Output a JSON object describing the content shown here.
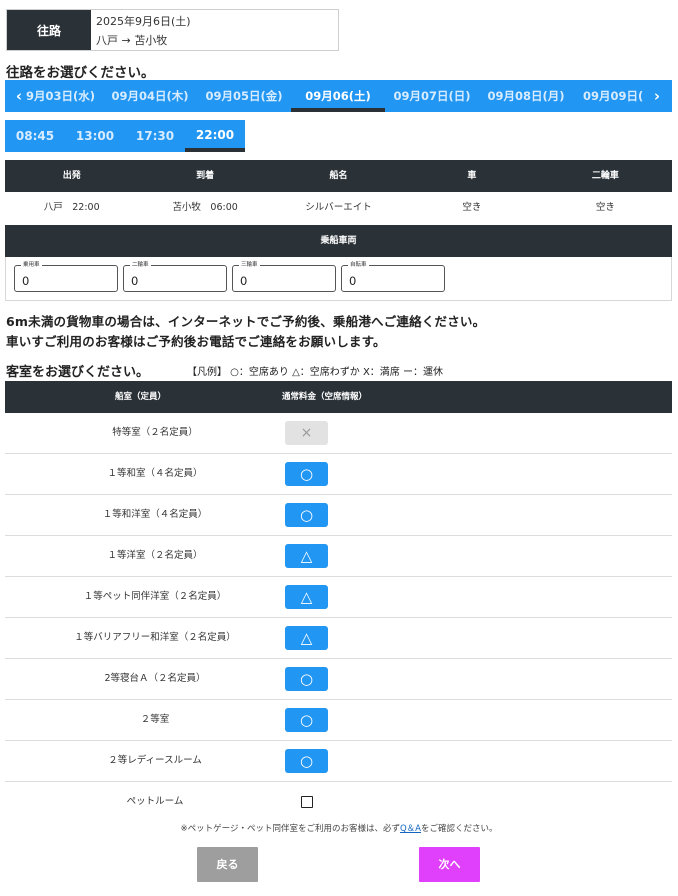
{
  "route": {
    "label": "往路",
    "date": "2025年9月6日(土)",
    "path": "八戸 → 苫小牧"
  },
  "date_section_title": "往路をお選びください。",
  "dates": {
    "prev_icon": "‹",
    "next_icon": "›",
    "items": [
      "9月03日(水)",
      "09月04日(木)",
      "09月05日(金)",
      "09月06(土)",
      "09月07日(日)",
      "09月08日(月)",
      "09月09日("
    ],
    "active_index": 3
  },
  "times": {
    "items": [
      "08:45",
      "13:00",
      "17:30",
      "22:00"
    ],
    "active_index": 3
  },
  "schedule": {
    "headers": [
      "出発",
      "到着",
      "船名",
      "車",
      "二輪車"
    ],
    "row": [
      "八戸　22:00",
      "苫小牧　06:00",
      "シルバーエイト",
      "空き",
      "空き"
    ]
  },
  "vehicles": {
    "header": "乗船車両",
    "fields": [
      {
        "legend": "乗用車",
        "value": "0"
      },
      {
        "legend": "二輪車",
        "value": "0"
      },
      {
        "legend": "三輪車",
        "value": "0"
      },
      {
        "legend": "自転車",
        "value": "0"
      }
    ]
  },
  "notice": {
    "line1": "6m未満の貨物車の場合は、インターネットでご予約後、乗船港へご連絡ください。",
    "line2": "車いすご利用のお客様はご予約後お電話でご連絡をお願いします。"
  },
  "rooms": {
    "title": "客室をお選びください。",
    "legend": "【凡例】 ○：空席あり △：空席わずか X：満席 ー：運休",
    "headers": {
      "name": "船室（定員）",
      "price": "通常料金（空席情報）"
    },
    "items": [
      {
        "name": "特等室（２名定員）",
        "status": "×",
        "state": "disabled"
      },
      {
        "name": "１等和室（４名定員）",
        "status": "○",
        "state": "available"
      },
      {
        "name": "１等和洋室（４名定員）",
        "status": "○",
        "state": "available"
      },
      {
        "name": "１等洋室（２名定員）",
        "status": "△",
        "state": "few"
      },
      {
        "name": "１等ペット同伴洋室（２名定員）",
        "status": "△",
        "state": "few"
      },
      {
        "name": "１等バリアフリー和洋室（２名定員）",
        "status": "△",
        "state": "few"
      },
      {
        "name": "2等寝台Ａ（２名定員）",
        "status": "○",
        "state": "available"
      },
      {
        "name": "２等室",
        "status": "○",
        "state": "available"
      },
      {
        "name": "２等レディースルーム",
        "status": "○",
        "state": "available"
      }
    ],
    "pet_room": {
      "name": "ペットルーム",
      "checked": false
    }
  },
  "footnote": {
    "before": "※ペットゲージ・ペット同伴室をご利用のお客様は、必ず",
    "link": "Q＆A",
    "after": "をご確認ください。"
  },
  "buttons": {
    "back": "戻る",
    "next": "次へ"
  },
  "colors": {
    "primary": "#2196f3",
    "dark_header": "#2a3238",
    "next_button": "#e040fb",
    "back_button": "#9e9e9e"
  }
}
